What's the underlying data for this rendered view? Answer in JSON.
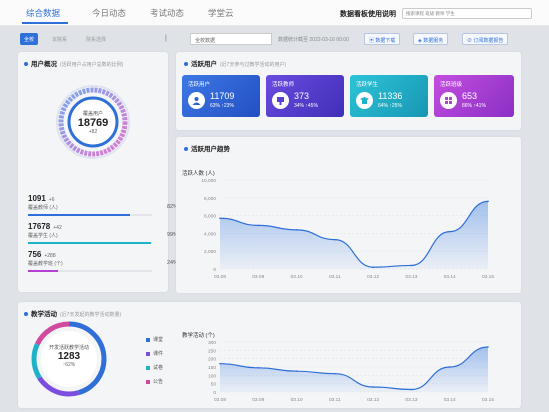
{
  "topnav": {
    "tabs": [
      "综合数据",
      "今日动态",
      "考试动态",
      "学堂云"
    ],
    "active_tab": 0,
    "right_title": "数据看板使用说明",
    "search_placeholder": "搜索课程 班级 教师 学生"
  },
  "filter": {
    "buttons": [
      "全校",
      "本院系",
      "院系选择"
    ],
    "divider": "|",
    "select_value": "全校数据",
    "timestamp": "数据统计截至 2022-03-16 00:00",
    "actions": [
      "数据下载",
      "数据服务",
      "订阅数据报告"
    ]
  },
  "user_overview": {
    "title": "用户概况",
    "subtitle": "(活跃用户占用户总数的比例)",
    "center_label": "覆盖用户",
    "center_value": "18769",
    "center_delta": "+82",
    "stats": [
      {
        "value": "1091",
        "delta": "+6",
        "label": "覆盖教师 (人)",
        "pct": "82%",
        "fraction": 0.82
      },
      {
        "value": "17678",
        "delta": "+42",
        "label": "覆盖学生 (人)",
        "pct": "99%",
        "fraction": 0.99
      },
      {
        "value": "756",
        "delta": "+288",
        "label": "覆盖教学班 (个)",
        "pct": "24%",
        "fraction": 0.24
      }
    ]
  },
  "active_users": {
    "title": "活跃用户",
    "subtitle": "(近7天参与过教学活动的用户)",
    "cards": [
      {
        "label": "活跃用户",
        "value": "11709",
        "meta": "63% ↑23%",
        "color": "#2e63d6"
      },
      {
        "label": "活跃教师",
        "value": "373",
        "meta": "34% ↑45%",
        "color": "#5a3fd0"
      },
      {
        "label": "活跃学生",
        "value": "11336",
        "meta": "64% ↑25%",
        "color": "#1fb3c9"
      },
      {
        "label": "活跃班级",
        "value": "653",
        "meta": "86% ↑41%",
        "color": "#b63fd4"
      }
    ]
  },
  "trend": {
    "title": "活跃用户趋势"
  },
  "teaching": {
    "title": "教学活动",
    "subtitle": "(近7天发起的教学活动数量)",
    "center_label": "开发活跃教学活动",
    "center_value": "1283",
    "center_delta": "↑62%",
    "legend": [
      "课堂",
      "课件",
      "试卷",
      "公告"
    ],
    "legend_colors": [
      "#2f6fd8",
      "#7b4ee0",
      "#1fb3c9",
      "#d04aa0"
    ]
  },
  "chart_data": [
    {
      "type": "area",
      "title": "",
      "ylabel": "活跃人数 (人)",
      "xlabel": "",
      "x": [
        "03.08",
        "03.09",
        "03.10",
        "03.11",
        "03.12",
        "03.13",
        "03.14",
        "03.15"
      ],
      "ylim": [
        0,
        10000
      ],
      "yticks": [
        0,
        2000,
        4000,
        6000,
        8000,
        10000
      ],
      "series": [
        {
          "values": [
            5700,
            4900,
            4400,
            3300,
            200,
            400,
            4200,
            7600
          ]
        }
      ],
      "grid": true
    },
    {
      "type": "area",
      "title": "",
      "ylabel": "教学活动 (个)",
      "xlabel": "",
      "x": [
        "03.08",
        "03.09",
        "03.10",
        "03.11",
        "03.12",
        "03.13",
        "03.14",
        "03.15"
      ],
      "ylim": [
        0,
        300
      ],
      "yticks": [
        0,
        50,
        100,
        150,
        200,
        250,
        300
      ],
      "series": [
        {
          "values": [
            170,
            145,
            125,
            110,
            30,
            15,
            150,
            270
          ]
        }
      ],
      "grid": true
    }
  ]
}
